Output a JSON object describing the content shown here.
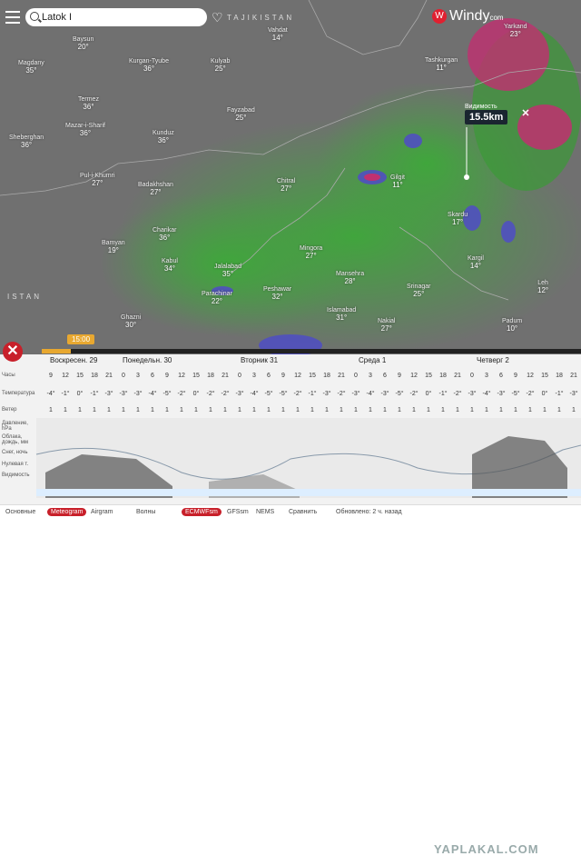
{
  "search": {
    "value": "Latok I"
  },
  "brand": {
    "name": "Windy",
    "suffix": "com"
  },
  "visibility": {
    "label": "Видимость",
    "value": "15.5km"
  },
  "timebadge": "15:00",
  "map_labels": {
    "countries": [
      "TAJIKISTAN",
      "ISTAN"
    ],
    "cities": [
      {
        "name": "Baysun",
        "t": "20°"
      },
      {
        "name": "Magdany",
        "t": "35°"
      },
      {
        "name": "Kurgan-Tyube",
        "t": "36°"
      },
      {
        "name": "Kulyab",
        "t": "25°"
      },
      {
        "name": "Vahdat",
        "t": "14°"
      },
      {
        "name": "Termez",
        "t": "36°"
      },
      {
        "name": "Mazar-i-Sharif",
        "t": "36°"
      },
      {
        "name": "Kunduz",
        "t": "36°"
      },
      {
        "name": "Fayzabad",
        "t": "25°"
      },
      {
        "name": "Sheberghan",
        "t": "36°"
      },
      {
        "name": "Pul-i-Khumri",
        "t": "27°"
      },
      {
        "name": "Badakhshan",
        "t": "27°"
      },
      {
        "name": "Chitral",
        "t": "27°"
      },
      {
        "name": "Gilgit",
        "t": "11°"
      },
      {
        "name": "Skardu",
        "t": "17°"
      },
      {
        "name": "Charikar",
        "t": "36°"
      },
      {
        "name": "Bamyan",
        "t": "19°"
      },
      {
        "name": "Kabul",
        "t": "34°"
      },
      {
        "name": "Jalalabad",
        "t": "35°"
      },
      {
        "name": "Mingora",
        "t": "27°"
      },
      {
        "name": "Peshawar",
        "t": "32°"
      },
      {
        "name": "Parachinar",
        "t": "22°"
      },
      {
        "name": "Islamabad",
        "t": "31°"
      },
      {
        "name": "Srinagar",
        "t": "25°"
      },
      {
        "name": "Kargil",
        "t": "14°"
      },
      {
        "name": "Leh",
        "t": "12°"
      },
      {
        "name": "Padum",
        "t": "10°"
      },
      {
        "name": "Nakial",
        "t": "27°"
      },
      {
        "name": "Ghazni",
        "t": "30°"
      },
      {
        "name": "Mansehra",
        "t": "28°"
      },
      {
        "name": "Tashkurgan",
        "t": "11°"
      },
      {
        "name": "Yarkand",
        "t": "23°"
      }
    ]
  },
  "forecast": {
    "days": [
      "Воскресен. 29",
      "Понедельн. 30",
      "Вторник 31",
      "Среда 1",
      "Четверг 2"
    ],
    "row_labels": {
      "hours": "Часы",
      "temp": "Температура",
      "wind": "Ветер",
      "pressure": "Давление, hPa",
      "clouds": "Облака, дождь, мм",
      "snow": "Снег, ночь",
      "freezing": "Нулевая т.",
      "visibility": "Видимость"
    },
    "hours": [
      "9",
      "12",
      "15",
      "18",
      "21",
      "0",
      "3",
      "6",
      "9",
      "12",
      "15",
      "18",
      "21",
      "0",
      "3",
      "6",
      "9",
      "12",
      "15",
      "18",
      "21",
      "0",
      "3",
      "6",
      "9",
      "12",
      "15",
      "18",
      "21",
      "0",
      "3",
      "6",
      "9",
      "12",
      "15",
      "18",
      "21"
    ],
    "temps": [
      "-4°",
      "-1°",
      "0°",
      "-1°",
      "-3°",
      "-3°",
      "-3°",
      "-4°",
      "-5°",
      "-2°",
      "0°",
      "-2°",
      "-2°",
      "-3°",
      "-4°",
      "-5°",
      "-5°",
      "-2°",
      "-1°",
      "-3°",
      "-2°",
      "-3°",
      "-4°",
      "-3°",
      "-5°",
      "-2°",
      "0°",
      "-1°",
      "-2°",
      "-3°",
      "-4°",
      "-3°",
      "-5°",
      "-2°",
      "0°",
      "-1°",
      "-3°"
    ],
    "wind": [
      "1",
      "1",
      "1",
      "1",
      "1",
      "1",
      "1",
      "1",
      "1",
      "1",
      "1",
      "1",
      "1",
      "1",
      "1",
      "1",
      "1",
      "1",
      "1",
      "1",
      "1",
      "1",
      "1",
      "1",
      "1",
      "1",
      "1",
      "1",
      "1",
      "1",
      "1",
      "1",
      "1",
      "1",
      "1",
      "1",
      "1"
    ]
  },
  "tabs": [
    "Основные",
    "Meteogram",
    "Airgram",
    "Волны",
    "ECMWFsm",
    "GFSsm",
    "NEMS",
    "Сравнить",
    "Обновлено: 2 ч. назад"
  ],
  "watermark": "YAPLAKAL.COM",
  "colors": {
    "accent": "#c8202a",
    "green": "#3c9a38",
    "map": "#6f6f6f"
  }
}
